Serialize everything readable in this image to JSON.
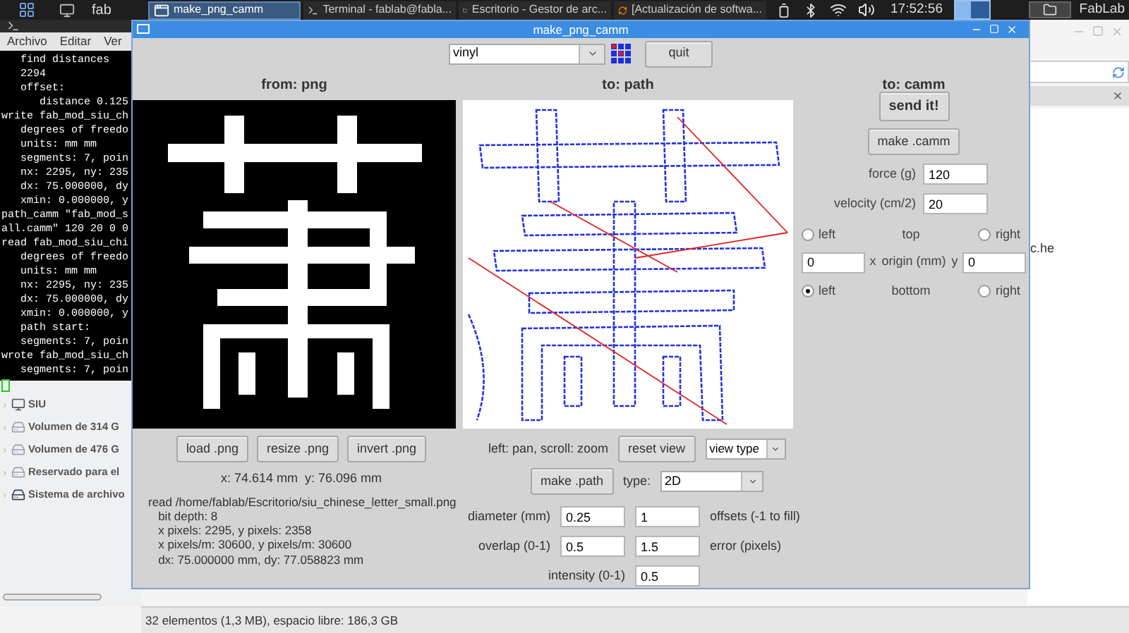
{
  "taskbar": {
    "workspace_label": "fab",
    "tasks": [
      {
        "label": "make_png_camm",
        "selected": true,
        "kind": "window"
      },
      {
        "label": "Terminal - fablab@fabla...",
        "selected": false,
        "kind": "terminal"
      },
      {
        "label": "Escritorio - Gestor de arc...",
        "selected": false,
        "kind": "folder"
      },
      {
        "label": "[Actualización de softwa...",
        "selected": false,
        "kind": "update"
      }
    ],
    "clock": "17:52:56",
    "user": "FabLab"
  },
  "terminal": {
    "menu": [
      "Archivo",
      "Editar",
      "Ver"
    ],
    "lines": [
      "   find distances",
      "   2294",
      "   offset:",
      "      distance 0.125",
      "write fab_mod_siu_ch",
      "   degrees of freedo",
      "   units: mm mm",
      "   segments: 7, poin",
      "   nx: 2295, ny: 235",
      "   dx: 75.000000, dy",
      "   xmin: 0.000000, y",
      "path_camm \"fab_mod_s",
      "all.camm\" 120 20 0 0",
      "read fab_mod_siu_chi",
      "   degrees of freedo",
      "   units: mm mm",
      "   nx: 2295, ny: 235",
      "   dx: 75.000000, dy",
      "   xmin: 0.000000, y",
      "   path start:",
      "   segments: 7, poin",
      "wrote fab_mod_siu_ch",
      "   segments: 7, poin"
    ]
  },
  "file_manager": {
    "places": [
      {
        "label": "SIU",
        "kind": "media"
      },
      {
        "label": "Volumen de 314 G",
        "kind": "disk"
      },
      {
        "label": "Volumen de 476 G",
        "kind": "disk"
      },
      {
        "label": "Reservado para el",
        "kind": "disk"
      },
      {
        "label": "Sistema de archivo",
        "kind": "system"
      }
    ],
    "file_text": "c.he",
    "status": "32 elementos (1,3 MB), espacio libre: 186,3 GB"
  },
  "dialog": {
    "title": "make_png_camm",
    "material": "vinyl",
    "quit": "quit",
    "from_heading": "from: png",
    "path_heading": "to: path",
    "camm_heading": "to: camm",
    "png_buttons": [
      "load .png",
      "resize .png",
      "invert .png"
    ],
    "cursor": "x: 74.614 mm  y: 76.096 mm",
    "log": [
      "read /home/fablab/Escritorio/siu_chinese_letter_small.png",
      "   bit depth: 8",
      "   x pixels: 2295, y pixels: 2358",
      "   x pixels/m: 30600, y pixels/m: 30600",
      "   dx: 75.000000 mm, dy: 77.058823 mm"
    ],
    "view_hint": "left: pan, scroll: zoom",
    "reset_view": "reset view",
    "view_type": "view type",
    "make_path": "make .path",
    "type_label": "type:",
    "type_value": "2D",
    "params": [
      {
        "label": "diameter (mm)",
        "value": "0.25",
        "value2": "1",
        "label2": "offsets (-1 to fill)"
      },
      {
        "label": "overlap (0-1)",
        "value": "0.5",
        "value2": "1.5",
        "label2": "error (pixels)"
      },
      {
        "label": "intensity (0-1)",
        "value": "0.5"
      }
    ],
    "send": "send it!",
    "make_camm": "make .camm",
    "fields": [
      {
        "label": "force (g)",
        "value": "120"
      },
      {
        "label": "velocity (cm/2)",
        "value": "20"
      }
    ],
    "origin": {
      "top_label": "top",
      "bottom_label": "bottom",
      "x_label": "x",
      "label": "origin (mm)",
      "y_label": "y",
      "x_value": "0",
      "y_value": "0",
      "corners": [
        {
          "label": "left",
          "selected": false
        },
        {
          "label": "right",
          "selected": false
        },
        {
          "label": "left",
          "selected": true
        },
        {
          "label": "right",
          "selected": false
        }
      ]
    }
  }
}
